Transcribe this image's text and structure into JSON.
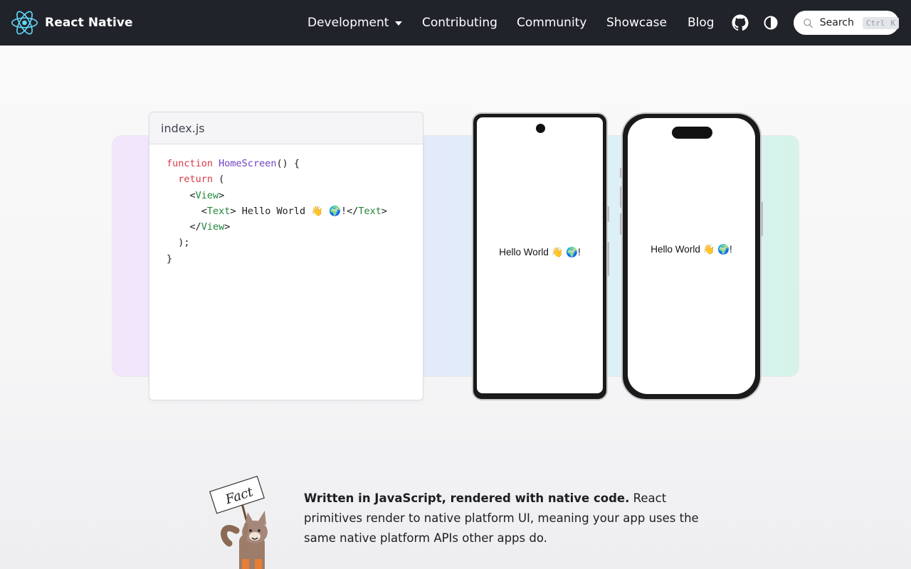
{
  "nav": {
    "brand": "React Native",
    "items": [
      {
        "label": "Development",
        "has_dropdown": true
      },
      {
        "label": "Contributing"
      },
      {
        "label": "Community"
      },
      {
        "label": "Showcase"
      },
      {
        "label": "Blog"
      }
    ],
    "github_icon": "github-icon",
    "theme_icon": "theme-toggle-icon",
    "search": {
      "label": "Search",
      "keys": [
        "Ctrl",
        "K"
      ]
    }
  },
  "editor": {
    "filename": "index.js",
    "code": {
      "l1_kw": "function",
      "l1_fn": "HomeScreen",
      "l1_rest": "() {",
      "l2_kw": "return",
      "l2_rest": " (",
      "l3_open": "<",
      "l3_tag": "View",
      "l3_close": ">",
      "l4_open": "<",
      "l4_tag": "Text",
      "l4_mid": "> Hello World 👋 🌍!</",
      "l4_tag2": "Text",
      "l4_close": ">",
      "l5_open": "</",
      "l5_tag": "View",
      "l5_close": ">",
      "l6": ");",
      "l7": "}"
    }
  },
  "phones": {
    "android_text": "Hello World 👋 🌍!",
    "ios_text": "Hello World 👋 🌍!"
  },
  "fact": {
    "sign": "Fact",
    "bold": "Written in JavaScript, rendered with native code.",
    "rest": " React primitives render to native platform UI, meaning your app uses the same native platform APIs other apps do."
  },
  "colors": {
    "navbar_bg": "#20232a",
    "react_blue": "#61dafb",
    "keyword": "#d73a49",
    "function": "#6f42c1",
    "tag": "#22863a"
  }
}
